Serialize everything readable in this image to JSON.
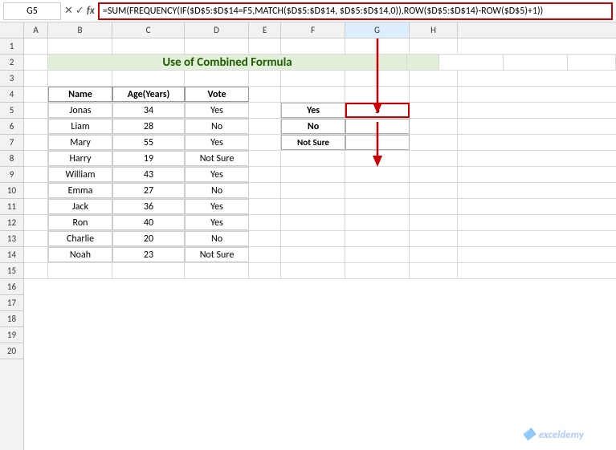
{
  "formulaBar": {
    "cellRef": "G5",
    "formula": "=SUM(FREQUENCY(IF($D$5:$D$14=F5,MATCH($D$5:$D$14, $D$5:$D$14,0)),ROW($D$5:$D$14)-ROW($D$5)+1))"
  },
  "title": "Use of Combined Formula",
  "columns": [
    "A",
    "B",
    "C",
    "D",
    "E",
    "F",
    "G",
    "H"
  ],
  "tableHeaders": [
    "Name",
    "Age(Years)",
    "Vote"
  ],
  "tableData": [
    {
      "name": "Jonas",
      "age": "34",
      "vote": "Yes"
    },
    {
      "name": "Liam",
      "age": "28",
      "vote": "No"
    },
    {
      "name": "Mary",
      "age": "55",
      "vote": "Yes"
    },
    {
      "name": "Harry",
      "age": "19",
      "vote": "Not Sure"
    },
    {
      "name": "William",
      "age": "43",
      "vote": "Yes"
    },
    {
      "name": "Emma",
      "age": "27",
      "vote": "No"
    },
    {
      "name": "Jack",
      "age": "36",
      "vote": "Yes"
    },
    {
      "name": "Ron",
      "age": "40",
      "vote": "Yes"
    },
    {
      "name": "Charlie",
      "age": "20",
      "vote": "No"
    },
    {
      "name": "Noah",
      "age": "23",
      "vote": "Not Sure"
    }
  ],
  "sideTable": {
    "rows": [
      {
        "label": "Yes",
        "value": "5"
      },
      {
        "label": "No",
        "value": ""
      },
      {
        "label": "Not Sure",
        "value": ""
      }
    ]
  },
  "watermark": "exceldemy",
  "rowNumbers": [
    "1",
    "2",
    "3",
    "4",
    "5",
    "6",
    "7",
    "8",
    "9",
    "10",
    "11",
    "12",
    "13",
    "14"
  ]
}
